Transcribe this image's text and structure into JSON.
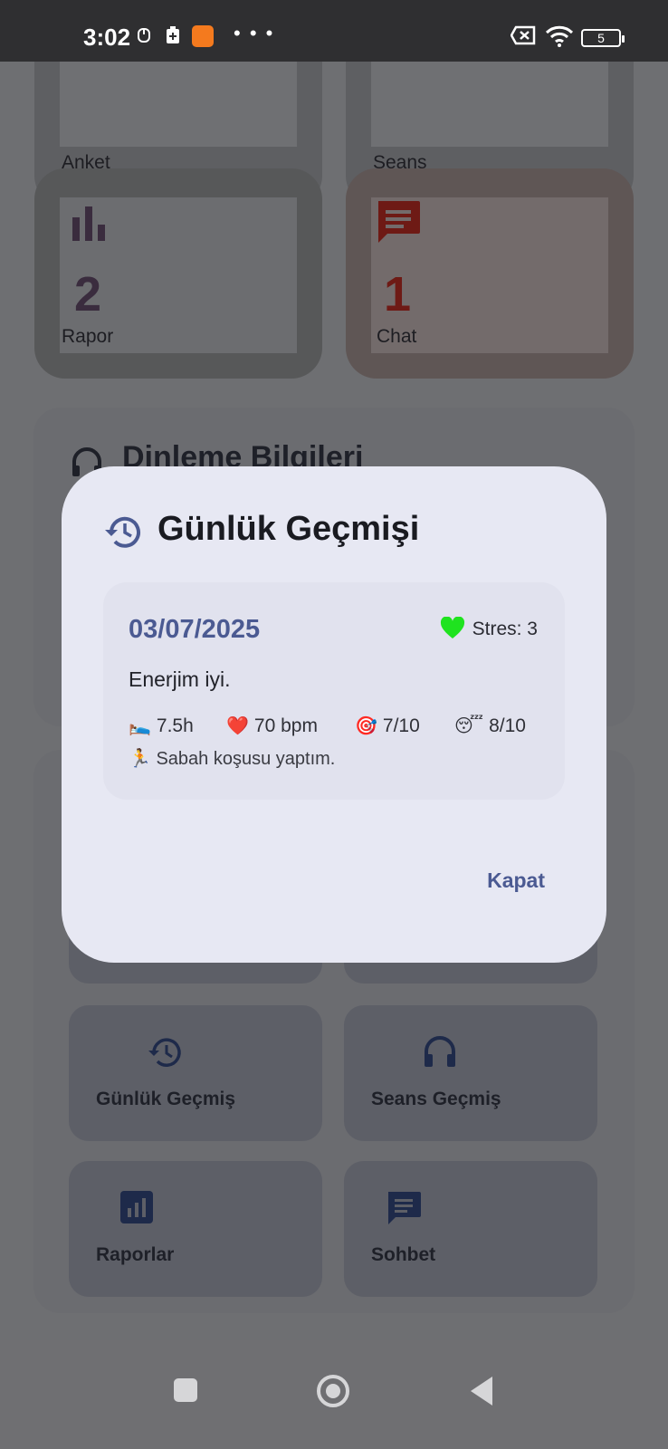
{
  "status_bar": {
    "time": "3:02",
    "battery": "5"
  },
  "background": {
    "top_stats": [
      {
        "label": "Anket"
      },
      {
        "label": "Seans"
      },
      {
        "value": "2",
        "label": "Rapor"
      },
      {
        "value": "1",
        "label": "Chat"
      }
    ],
    "section_title": "Dinleme Bilgileri",
    "actions": [
      {
        "label": "Günlük Geçmiş",
        "icon": "history-icon"
      },
      {
        "label": "Seans Geçmiş",
        "icon": "headphones-icon"
      },
      {
        "label": "Raporlar",
        "icon": "bar-chart-icon"
      },
      {
        "label": "Sohbet",
        "icon": "chat-icon"
      }
    ]
  },
  "dialog": {
    "title": "Günlük Geçmişi",
    "entry": {
      "date": "03/07/2025",
      "stress": "Stres: 3",
      "note": "Enerjim iyi.",
      "sleep": "7.5h",
      "heart_rate": "70 bpm",
      "focus": "7/10",
      "rest": "8/10",
      "activity": "Sabah koşusu yaptım."
    },
    "close_label": "Kapat"
  },
  "colors": {
    "accent": "#4b5a92",
    "dialog_bg": "#e7e8f3",
    "stress_heart": "#1fe31f"
  }
}
